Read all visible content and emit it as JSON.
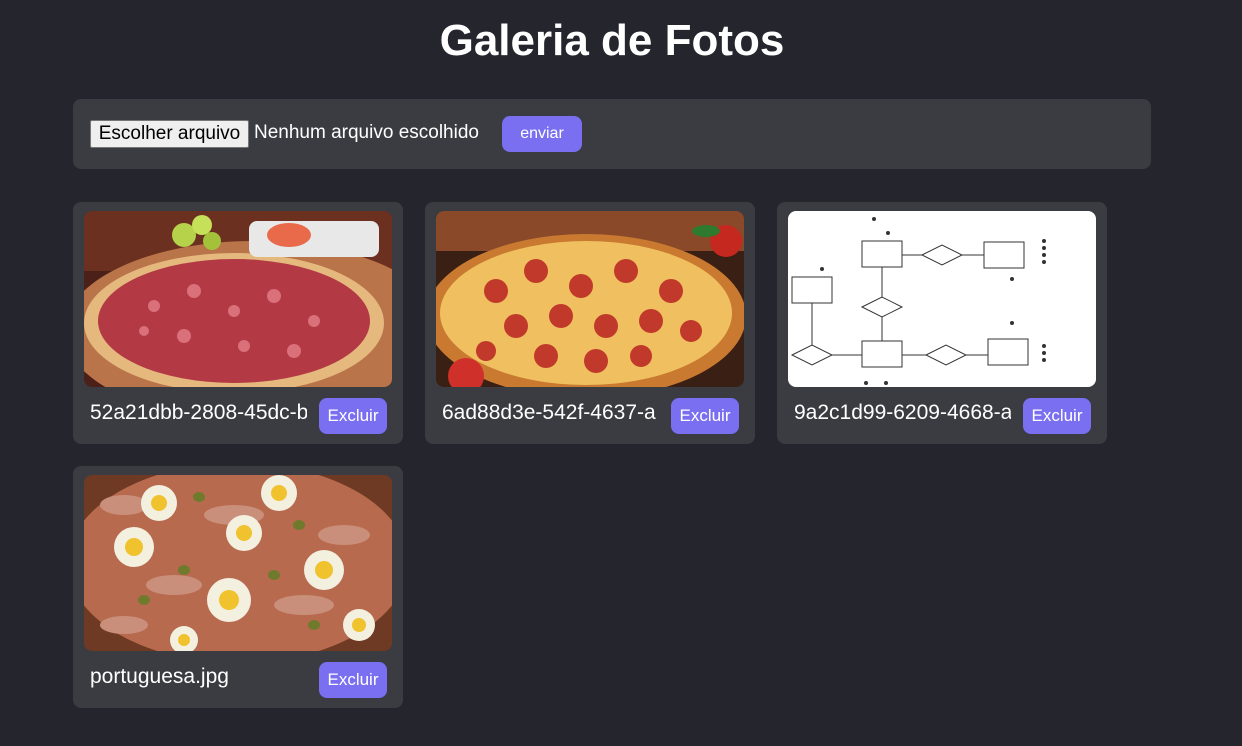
{
  "header": {
    "title": "Galeria de Fotos"
  },
  "upload": {
    "file_button_label": "Escolher arquivo",
    "file_status": "Nenhum arquivo escolhido",
    "submit_label": "enviar"
  },
  "gallery": {
    "items": [
      {
        "filename": "52a21dbb-2808-45dc-b",
        "delete_label": "Excluir",
        "image": "pizza-calabresa-photo"
      },
      {
        "filename": "6ad88d3e-542f-4637-a",
        "delete_label": "Excluir",
        "image": "pizza-pepperoni-photo"
      },
      {
        "filename": "9a2c1d99-6209-4668-a",
        "delete_label": "Excluir",
        "image": "er-diagram-image"
      },
      {
        "filename": "portuguesa.jpg",
        "delete_label": "Excluir",
        "image": "pizza-portuguesa-photo"
      }
    ]
  },
  "colors": {
    "background": "#24252d",
    "panel": "#3b3c42",
    "accent": "#7a6ff0"
  }
}
